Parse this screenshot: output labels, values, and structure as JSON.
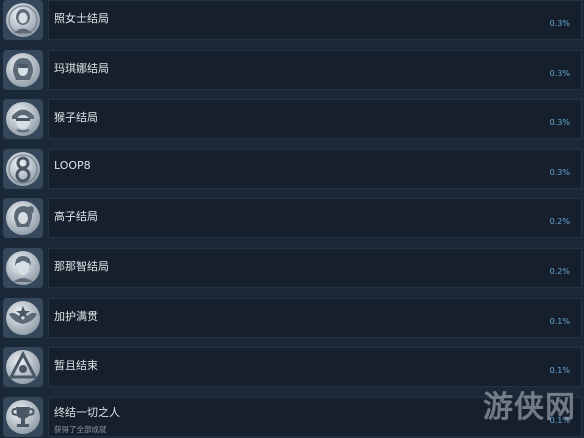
{
  "achievements": [
    {
      "name": "照女士结局",
      "percent": "0.3%",
      "icon": "woman-portrait-icon"
    },
    {
      "name": "玛琪娜结局",
      "percent": "0.3%",
      "icon": "girl-portrait-icon"
    },
    {
      "name": "猴子结局",
      "percent": "0.3%",
      "icon": "monkey-portrait-icon"
    },
    {
      "name": "LOOP8",
      "percent": "0.3%",
      "icon": "number-eight-icon"
    },
    {
      "name": "高子结局",
      "percent": "0.2%",
      "icon": "ponytail-girl-icon"
    },
    {
      "name": "那那智结局",
      "percent": "0.2%",
      "icon": "boy-portrait-icon"
    },
    {
      "name": "加护满贯",
      "percent": "0.1%",
      "icon": "wings-emblem-icon"
    },
    {
      "name": "暂且结束",
      "percent": "0.1%",
      "icon": "triangle-emblem-icon"
    },
    {
      "name": "终结一切之人",
      "description": "获得了全部成就",
      "percent": "0.1%",
      "icon": "trophy-icon"
    }
  ],
  "watermark": "游侠网",
  "colors": {
    "background": "#1b2838",
    "panel": "#16202d",
    "panel_border": "#243244",
    "name_text": "#dfe3e6",
    "percent_text": "#67a8d8",
    "icon_silver": "#c9d1d8"
  }
}
